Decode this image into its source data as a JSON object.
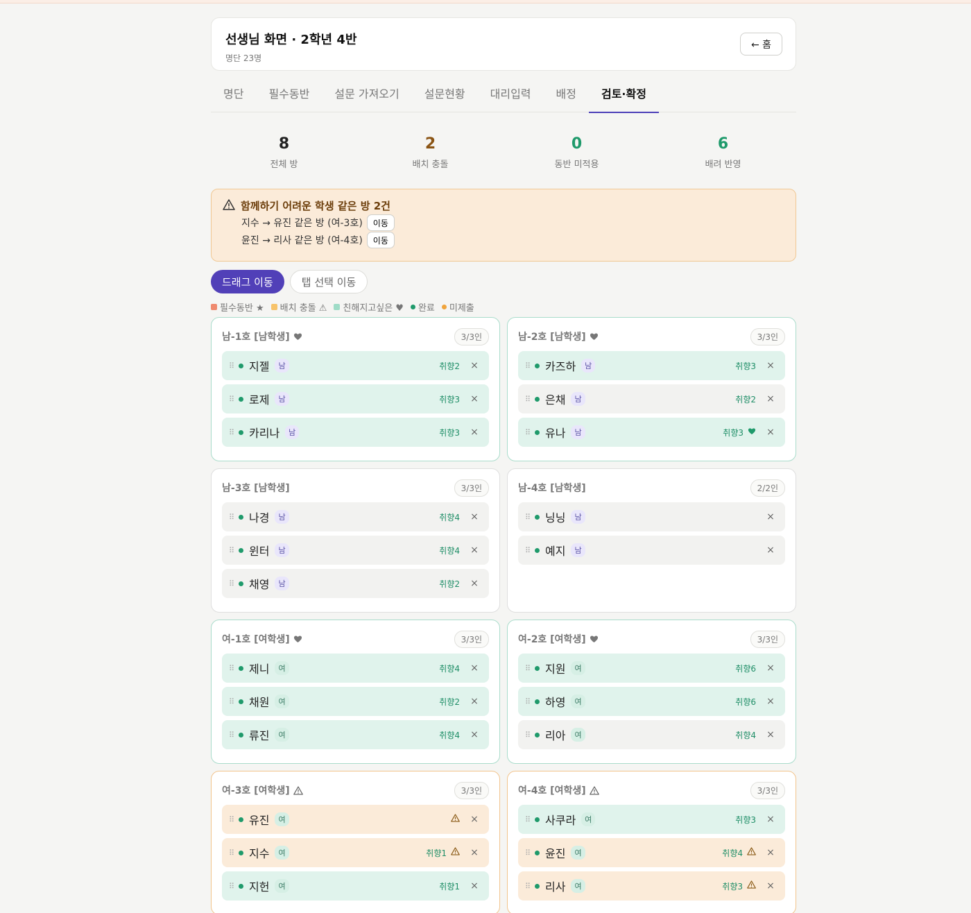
{
  "header": {
    "title": "선생님 화면 · 2학년 4반",
    "subtitle": "명단 23명",
    "home_label": "← 홈"
  },
  "tabs": [
    {
      "label": "명단"
    },
    {
      "label": "필수동반"
    },
    {
      "label": "설문 가져오기"
    },
    {
      "label": "설문현황"
    },
    {
      "label": "대리입력"
    },
    {
      "label": "배정"
    },
    {
      "label": "검토·확정"
    }
  ],
  "active_tab": "검토·확정",
  "stats": [
    {
      "num": "8",
      "label": "전체 방",
      "color": "#222222"
    },
    {
      "num": "2",
      "label": "배치 충돌",
      "color": "#8a5414"
    },
    {
      "num": "0",
      "label": "동반 미적용",
      "color": "#1f9a6b"
    },
    {
      "num": "6",
      "label": "배려 반영",
      "color": "#1f9a6b"
    }
  ],
  "alert": {
    "title": "함께하기 어려운 학생 같은 방 2건",
    "lines": [
      {
        "text": "지수 → 유진 같은 방 (여-3호)",
        "button": "이동"
      },
      {
        "text": "윤진 → 리사 같은 방 (여-4호)",
        "button": "이동"
      }
    ]
  },
  "modes": {
    "drag": "드래그 이동",
    "tap": "탭 선택 이동"
  },
  "legend": {
    "required": "필수동반 ★",
    "conflict": "배치 충돌 ⚠",
    "friend": "친해지고싶은 ♥",
    "done": "완료",
    "pending": "미제출",
    "colors": {
      "required": "#ef8a6f",
      "conflict": "#f7c36a",
      "friend": "#9fdcc7",
      "done": "#1f9a6b",
      "pending": "#f0a43c"
    }
  },
  "rooms": [
    {
      "title": "남-1호 [남학생]",
      "icon": "heart",
      "cap": "3/3인",
      "style": "calm",
      "members": [
        {
          "name": "지젤",
          "g": "남",
          "pref": "취향2",
          "bg": "mint"
        },
        {
          "name": "로제",
          "g": "남",
          "pref": "취향3",
          "bg": "mint"
        },
        {
          "name": "카리나",
          "g": "남",
          "pref": "취향3",
          "bg": "mint"
        }
      ]
    },
    {
      "title": "남-2호 [남학생]",
      "icon": "heart",
      "cap": "3/3인",
      "style": "calm",
      "members": [
        {
          "name": "카즈하",
          "g": "남",
          "pref": "취향3",
          "bg": "mint"
        },
        {
          "name": "은채",
          "g": "남",
          "pref": "취향2",
          "bg": "grey"
        },
        {
          "name": "유나",
          "g": "남",
          "pref": "취향3",
          "bg": "mint",
          "extra": "♥"
        }
      ]
    },
    {
      "title": "남-3호 [남학생]",
      "icon": "",
      "cap": "3/3인",
      "style": "plain",
      "members": [
        {
          "name": "나경",
          "g": "남",
          "pref": "취향4",
          "bg": "grey"
        },
        {
          "name": "윈터",
          "g": "남",
          "pref": "취향4",
          "bg": "grey"
        },
        {
          "name": "채영",
          "g": "남",
          "pref": "취향2",
          "bg": "grey"
        }
      ]
    },
    {
      "title": "남-4호 [남학생]",
      "icon": "",
      "cap": "2/2인",
      "style": "plain",
      "members": [
        {
          "name": "닝닝",
          "g": "남",
          "pref": "",
          "bg": "grey"
        },
        {
          "name": "예지",
          "g": "남",
          "pref": "",
          "bg": "grey"
        }
      ]
    },
    {
      "title": "여-1호 [여학생]",
      "icon": "heart",
      "cap": "3/3인",
      "style": "calm",
      "members": [
        {
          "name": "제니",
          "g": "여",
          "pref": "취향4",
          "bg": "mint"
        },
        {
          "name": "채원",
          "g": "여",
          "pref": "취향2",
          "bg": "mint"
        },
        {
          "name": "류진",
          "g": "여",
          "pref": "취향4",
          "bg": "mint"
        }
      ]
    },
    {
      "title": "여-2호 [여학생]",
      "icon": "heart",
      "cap": "3/3인",
      "style": "calm",
      "members": [
        {
          "name": "지원",
          "g": "여",
          "pref": "취향6",
          "bg": "mint"
        },
        {
          "name": "하영",
          "g": "여",
          "pref": "취향6",
          "bg": "mint"
        },
        {
          "name": "리아",
          "g": "여",
          "pref": "취향4",
          "bg": "grey"
        }
      ]
    },
    {
      "title": "여-3호 [여학생]",
      "icon": "warn",
      "cap": "3/3인",
      "style": "warn",
      "members": [
        {
          "name": "유진",
          "g": "여",
          "pref": "",
          "bg": "peach",
          "warn": "⚠"
        },
        {
          "name": "지수",
          "g": "여",
          "pref": "취향1",
          "bg": "peach",
          "warn": "⚠"
        },
        {
          "name": "지헌",
          "g": "여",
          "pref": "취향1",
          "bg": "mint"
        }
      ]
    },
    {
      "title": "여-4호 [여학생]",
      "icon": "warn",
      "cap": "3/3인",
      "style": "warn",
      "members": [
        {
          "name": "사쿠라",
          "g": "여",
          "pref": "취향3",
          "bg": "mint"
        },
        {
          "name": "윤진",
          "g": "여",
          "pref": "취향4",
          "bg": "peach",
          "warn": "⚠"
        },
        {
          "name": "리사",
          "g": "여",
          "pref": "취향3",
          "bg": "peach",
          "warn": "⚠"
        }
      ]
    }
  ]
}
